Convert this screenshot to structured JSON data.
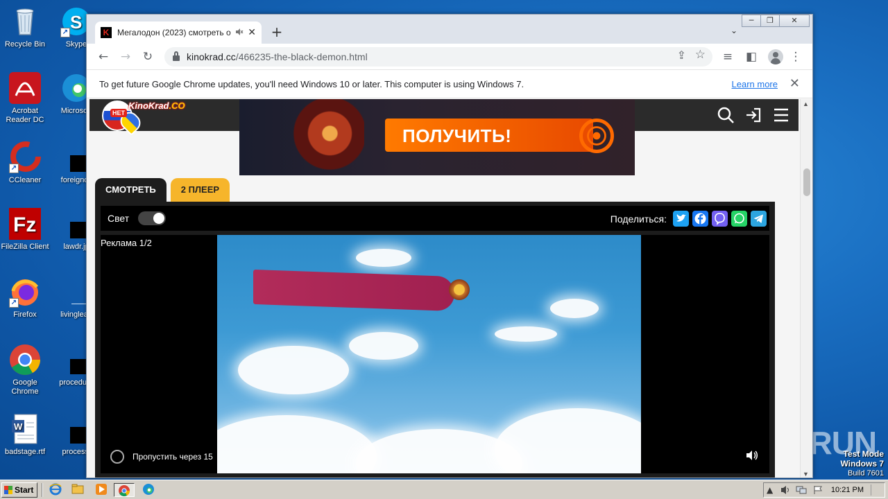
{
  "desktop": {
    "icons_left": [
      {
        "label": "Recycle Bin",
        "icon": "recycle-bin-icon"
      },
      {
        "label": "Acrobat Reader DC",
        "icon": "acrobat-icon"
      },
      {
        "label": "CCleaner",
        "icon": "ccleaner-icon"
      },
      {
        "label": "FileZilla Client",
        "icon": "filezilla-icon"
      },
      {
        "label": "Firefox",
        "icon": "firefox-icon"
      },
      {
        "label": "Google Chrome",
        "icon": "chrome-icon"
      },
      {
        "label": "badstage.rtf",
        "icon": "word-doc-icon"
      }
    ],
    "icons_right": [
      {
        "label": "Skype",
        "icon": "skype-icon"
      },
      {
        "label": "Microsoft",
        "icon": "edge-icon"
      },
      {
        "label": "foreignoil",
        "icon": "black-file-icon"
      },
      {
        "label": "lawdr.jp",
        "icon": "black-file-icon"
      },
      {
        "label": "livinglead",
        "icon": "black-file-icon"
      },
      {
        "label": "procedure",
        "icon": "black-file-icon"
      },
      {
        "label": "processi",
        "icon": "black-file-icon"
      }
    ]
  },
  "browser": {
    "tab": {
      "title": "Мегалодон (2023) смотреть о",
      "favicon_text": "K",
      "mute_icon": "speaker-muted-icon",
      "close_glyph": "✕"
    },
    "newtab_glyph": "+",
    "tab_search_glyph": "⌄",
    "window_buttons": {
      "minimize": "─",
      "restore": "❐",
      "close": "✕"
    },
    "nav": {
      "back": "←",
      "forward": "→",
      "reload": "↻"
    },
    "url": {
      "host": "kinokrad.cc",
      "path": "/466235-the-black-demon.html"
    },
    "omnibox_icons": {
      "share": "⇪",
      "star": "☆"
    },
    "toolbar_icons": {
      "media": "≡",
      "sidepanel": "◧",
      "menu": "⋮"
    },
    "infobar": {
      "message": "To get future Google Chrome updates, you'll need Windows 10 or later. This computer is using Windows 7.",
      "link": "Learn more",
      "close_glyph": "✕"
    }
  },
  "site": {
    "logo": {
      "badge_text": "НЕТ",
      "name_main": "KinoKrad",
      "name_tld": ".CO"
    },
    "header_icons": {
      "search": "⚲",
      "login": "⇥",
      "menu": "☰"
    },
    "banner": {
      "cta": "ПОЛУЧИТЬ!"
    },
    "player_tabs": [
      {
        "label": "СМОТРЕТЬ",
        "active": true
      },
      {
        "label": "2 ПЛЕЕР",
        "active": false
      }
    ],
    "player": {
      "light_label": "Свет",
      "light_on": true,
      "share_label": "Поделиться:",
      "social": [
        {
          "name": "twitter",
          "glyph": "t",
          "color": "#1da1f2"
        },
        {
          "name": "facebook",
          "glyph": "f",
          "color": "#1877f2"
        },
        {
          "name": "viber",
          "glyph": "v",
          "color": "#7360f2"
        },
        {
          "name": "whatsapp",
          "glyph": "w",
          "color": "#25d366"
        },
        {
          "name": "telegram",
          "glyph": "➤",
          "color": "#2ca5e0"
        }
      ],
      "ad_label": "Реклама 1/2",
      "skip_label": "Пропустить через 15",
      "volume_glyph": "🔊"
    }
  },
  "watermark": {
    "text": "ANY▷RUN"
  },
  "testmode": {
    "line1": "Test Mode",
    "line2": "Windows 7",
    "line3": "Build 7601"
  },
  "taskbar": {
    "start_label": "Start",
    "apps": [
      "ie-icon",
      "explorer-icon",
      "media-player-icon",
      "chrome-icon",
      "edge-icon"
    ],
    "clock": "10:21 PM"
  }
}
